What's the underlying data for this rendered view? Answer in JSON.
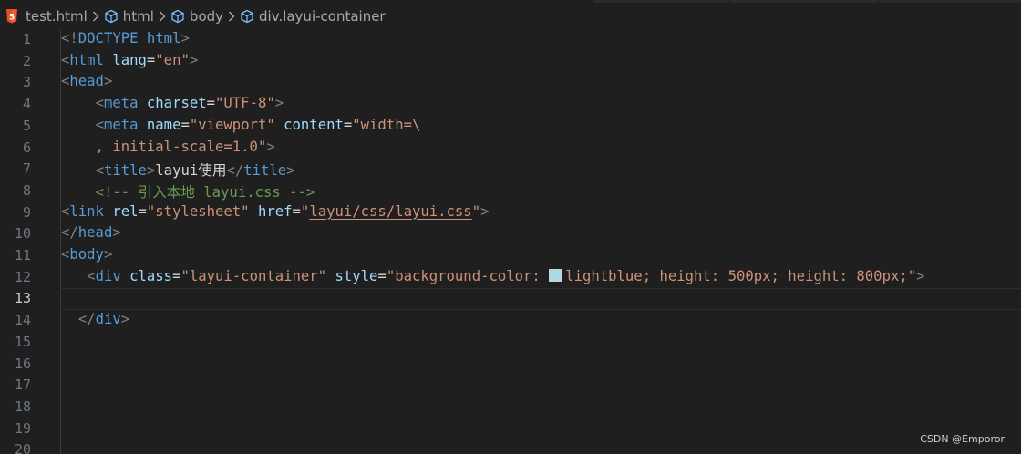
{
  "breadcrumb": {
    "file": "test.html",
    "items": [
      "html",
      "body",
      "div.layui-container"
    ]
  },
  "lines": [
    {
      "num": "1"
    },
    {
      "num": "2"
    },
    {
      "num": "3"
    },
    {
      "num": "4"
    },
    {
      "num": "5"
    },
    {
      "num": "6"
    },
    {
      "num": "7"
    },
    {
      "num": "8"
    },
    {
      "num": "9"
    },
    {
      "num": "10"
    },
    {
      "num": "11"
    },
    {
      "num": "12"
    },
    {
      "num": "13"
    },
    {
      "num": "14"
    },
    {
      "num": "15"
    },
    {
      "num": "16"
    },
    {
      "num": "17"
    },
    {
      "num": "18"
    },
    {
      "num": "19"
    },
    {
      "num": "20"
    }
  ],
  "code": {
    "l1": {
      "open": "<!",
      "kw": "DOCTYPE",
      "name": "html",
      "close": ">"
    },
    "l2": {
      "tag": "html",
      "attr": "lang",
      "val": "\"en\""
    },
    "l3": {
      "tag": "head"
    },
    "l4": {
      "tag": "meta",
      "attr": "charset",
      "val": "\"UTF-8\""
    },
    "l5": {
      "tag": "meta",
      "attr1": "name",
      "val1": "\"viewport\"",
      "attr2": "content",
      "val2": "\"width=\\"
    },
    "l6": {
      "val": ", initial-scale=1.0\""
    },
    "l7": {
      "tag": "title",
      "text": "layui使用"
    },
    "l8": {
      "comment": "<!-- 引入本地 layui.css -->"
    },
    "l9": {
      "tag": "link",
      "attr1": "rel",
      "val1": "\"stylesheet\"",
      "attr2": "href",
      "val2_q": "\"",
      "val2_link": "layui/css/layui.css",
      "val2_end": "\""
    },
    "l10": {
      "tag": "head"
    },
    "l11": {
      "tag": "body"
    },
    "l12": {
      "tag": "div",
      "attr1": "class",
      "val1": "\"layui-container\"",
      "attr2": "style",
      "style_prefix": "\"background-color: ",
      "style_rest": "lightblue; height: 500px; height: 800px;\""
    },
    "l14": {
      "tag": "div"
    }
  },
  "colors": {
    "swatch": "#add8e6",
    "html5_badge": "#e44d26",
    "cube": "#75beff"
  },
  "icons": {
    "file": "html5-icon",
    "element": "cube-icon",
    "separator": "chevron-right-icon"
  },
  "watermark": "CSDN @Emporor"
}
